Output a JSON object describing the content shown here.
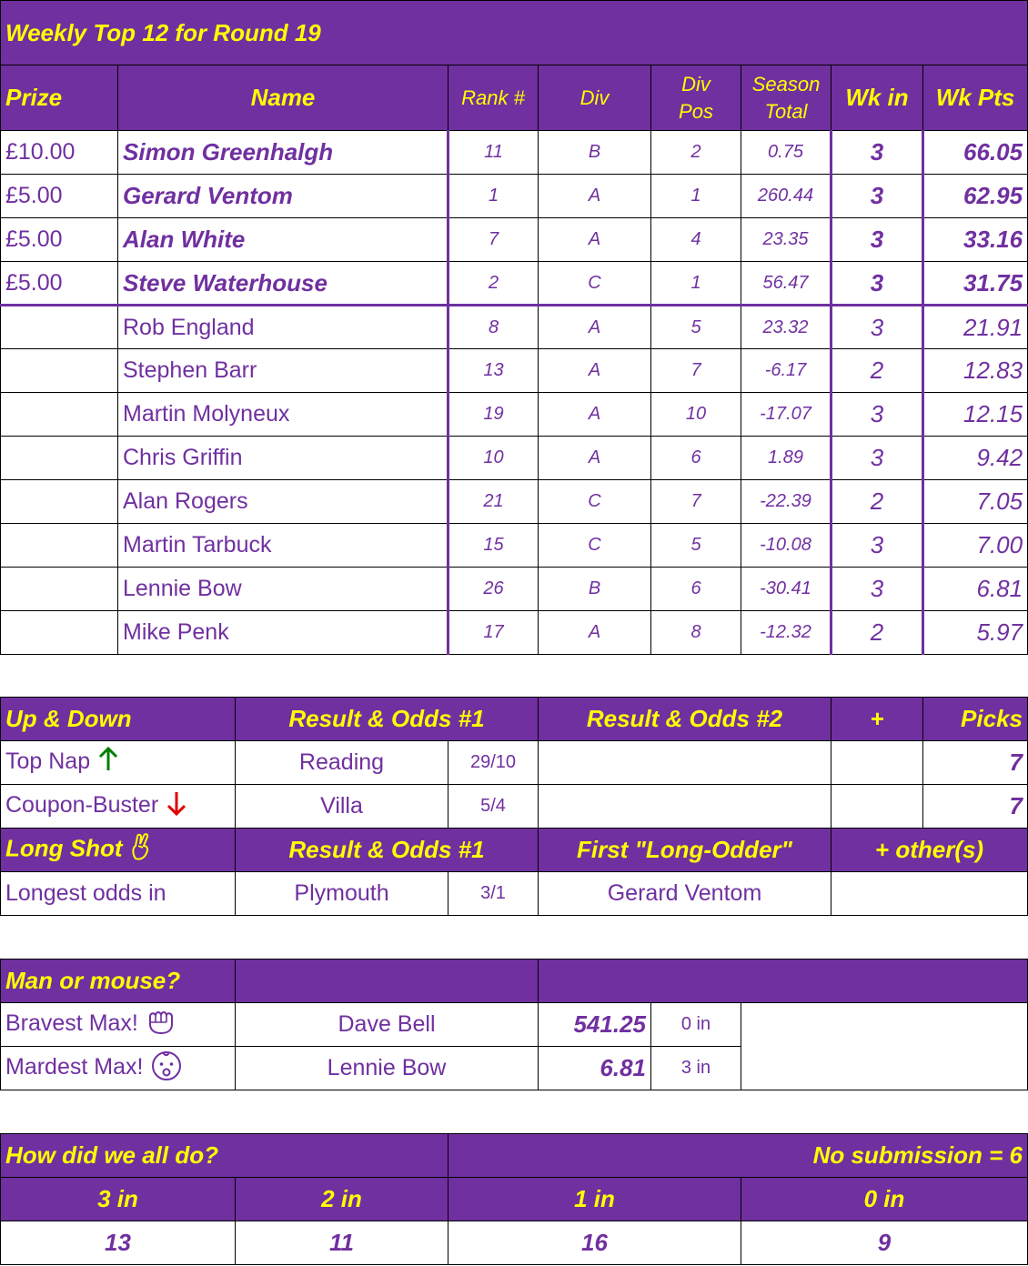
{
  "top12": {
    "title": "Weekly Top 12 for Round 19",
    "headers": {
      "prize": "Prize",
      "name": "Name",
      "rank": "Rank #",
      "div": "Div",
      "div_pos_1": "Div",
      "div_pos_2": "Pos",
      "season_1": "Season",
      "season_2": "Total",
      "wk_in": "Wk in",
      "wk_pts": "Wk Pts"
    },
    "rows": [
      {
        "prize": "£10.00",
        "name": "Simon Greenhalgh",
        "rank": "11",
        "div": "B",
        "div_pos": "2",
        "season_total": "0.75",
        "wk_in": "3",
        "wk_pts": "66.05"
      },
      {
        "prize": "£5.00",
        "name": "Gerard Ventom",
        "rank": "1",
        "div": "A",
        "div_pos": "1",
        "season_total": "260.44",
        "wk_in": "3",
        "wk_pts": "62.95"
      },
      {
        "prize": "£5.00",
        "name": "Alan White",
        "rank": "7",
        "div": "A",
        "div_pos": "4",
        "season_total": "23.35",
        "wk_in": "3",
        "wk_pts": "33.16"
      },
      {
        "prize": "£5.00",
        "name": "Steve Waterhouse",
        "rank": "2",
        "div": "C",
        "div_pos": "1",
        "season_total": "56.47",
        "wk_in": "3",
        "wk_pts": "31.75"
      },
      {
        "prize": "",
        "name": "Rob England",
        "rank": "8",
        "div": "A",
        "div_pos": "5",
        "season_total": "23.32",
        "wk_in": "3",
        "wk_pts": "21.91"
      },
      {
        "prize": "",
        "name": "Stephen Barr",
        "rank": "13",
        "div": "A",
        "div_pos": "7",
        "season_total": "-6.17",
        "wk_in": "2",
        "wk_pts": "12.83"
      },
      {
        "prize": "",
        "name": "Martin Molyneux",
        "rank": "19",
        "div": "A",
        "div_pos": "10",
        "season_total": "-17.07",
        "wk_in": "3",
        "wk_pts": "12.15"
      },
      {
        "prize": "",
        "name": "Chris Griffin",
        "rank": "10",
        "div": "A",
        "div_pos": "6",
        "season_total": "1.89",
        "wk_in": "3",
        "wk_pts": "9.42"
      },
      {
        "prize": "",
        "name": "Alan Rogers",
        "rank": "21",
        "div": "C",
        "div_pos": "7",
        "season_total": "-22.39",
        "wk_in": "2",
        "wk_pts": "7.05"
      },
      {
        "prize": "",
        "name": "Martin Tarbuck",
        "rank": "15",
        "div": "C",
        "div_pos": "5",
        "season_total": "-10.08",
        "wk_in": "3",
        "wk_pts": "7.00"
      },
      {
        "prize": "",
        "name": "Lennie Bow",
        "rank": "26",
        "div": "B",
        "div_pos": "6",
        "season_total": "-30.41",
        "wk_in": "3",
        "wk_pts": "6.81"
      },
      {
        "prize": "",
        "name": "Mike Penk",
        "rank": "17",
        "div": "A",
        "div_pos": "8",
        "season_total": "-12.32",
        "wk_in": "2",
        "wk_pts": "5.97"
      }
    ]
  },
  "updown": {
    "headers": {
      "title": "Up & Down",
      "result1": "Result & Odds #1",
      "result2": "Result & Odds #2",
      "plus": "+",
      "picks": "Picks"
    },
    "top_nap": {
      "label": "Top Nap",
      "team": "Reading",
      "odds": "29/10",
      "picks": "7",
      "icon": "arrow-up-icon",
      "icon_color": "#008000"
    },
    "coupon_buster": {
      "label": "Coupon-Buster",
      "team": "Villa",
      "odds": "5/4",
      "picks": "7",
      "icon": "arrow-down-icon",
      "icon_color": "#e00000"
    },
    "longshot_headers": {
      "title": "Long Shot",
      "result1": "Result & Odds #1",
      "first": "First \"Long-Odder\"",
      "others": "+ other(s)"
    },
    "longshot": {
      "label": "Longest odds in",
      "team": "Plymouth",
      "odds": "3/1",
      "first": "Gerard Ventom",
      "icon": "crossed-fingers-icon"
    }
  },
  "manmouse": {
    "title": "Man or mouse?",
    "bravest": {
      "label": "Bravest Max!",
      "name": "Dave Bell",
      "value": "541.25",
      "in": "0 in",
      "icon": "fist-icon"
    },
    "mardest": {
      "label": "Mardest Max!",
      "name": "Lennie Bow",
      "value": "6.81",
      "in": "3 in",
      "icon": "baby-face-icon"
    }
  },
  "summary": {
    "title": "How did we all do?",
    "no_submission": "No submission = 6",
    "headers": [
      "3 in",
      "2 in",
      "1 in",
      "0 in"
    ],
    "values": [
      "13",
      "11",
      "16",
      "9"
    ]
  },
  "colors": {
    "purple": "#7030a0",
    "yellow": "#ffff00",
    "green": "#008000",
    "red": "#e00000"
  }
}
